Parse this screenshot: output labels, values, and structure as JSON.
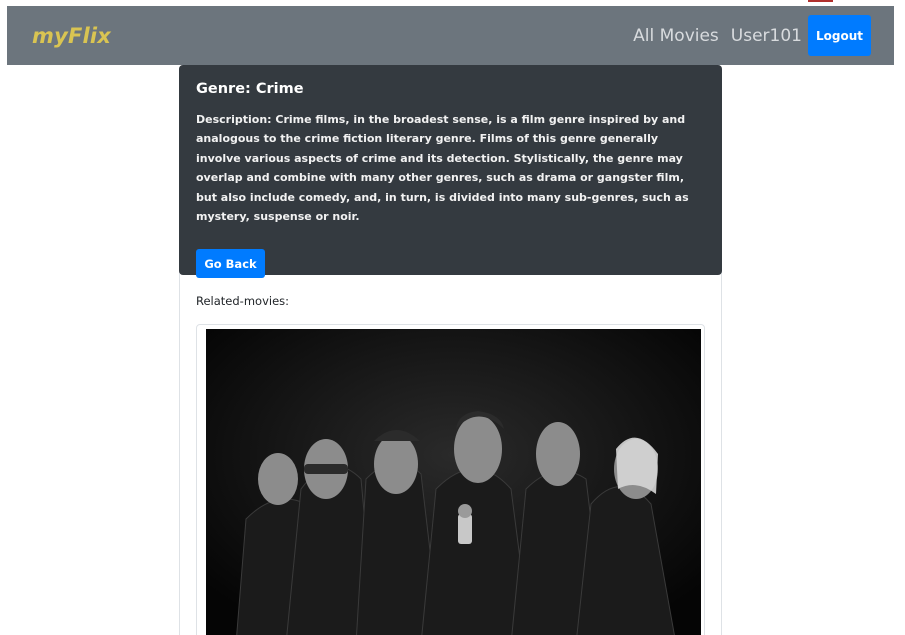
{
  "navbar": {
    "brand": "myFlix",
    "links": [
      "All Movies",
      "User101"
    ],
    "logout_label": "Logout",
    "colors": {
      "background": "#6c757d",
      "brand": "#d9c452",
      "button": "#007bff"
    }
  },
  "genre": {
    "title": "Genre: Crime",
    "description": "Description: Crime films, in the broadest sense, is a film genre inspired by and analogous to the crime fiction literary genre. Films of this genre generally involve various aspects of crime and its detection. Stylistically, the genre may overlap and combine with many other genres, such as drama or gangster film, but also include comedy, and, in turn, is divided into many sub-genres, such as mystery, suspense or noir.",
    "back_label": "Go Back"
  },
  "related": {
    "label": "Related-movies:",
    "poster_icon": "movie-poster-image"
  }
}
